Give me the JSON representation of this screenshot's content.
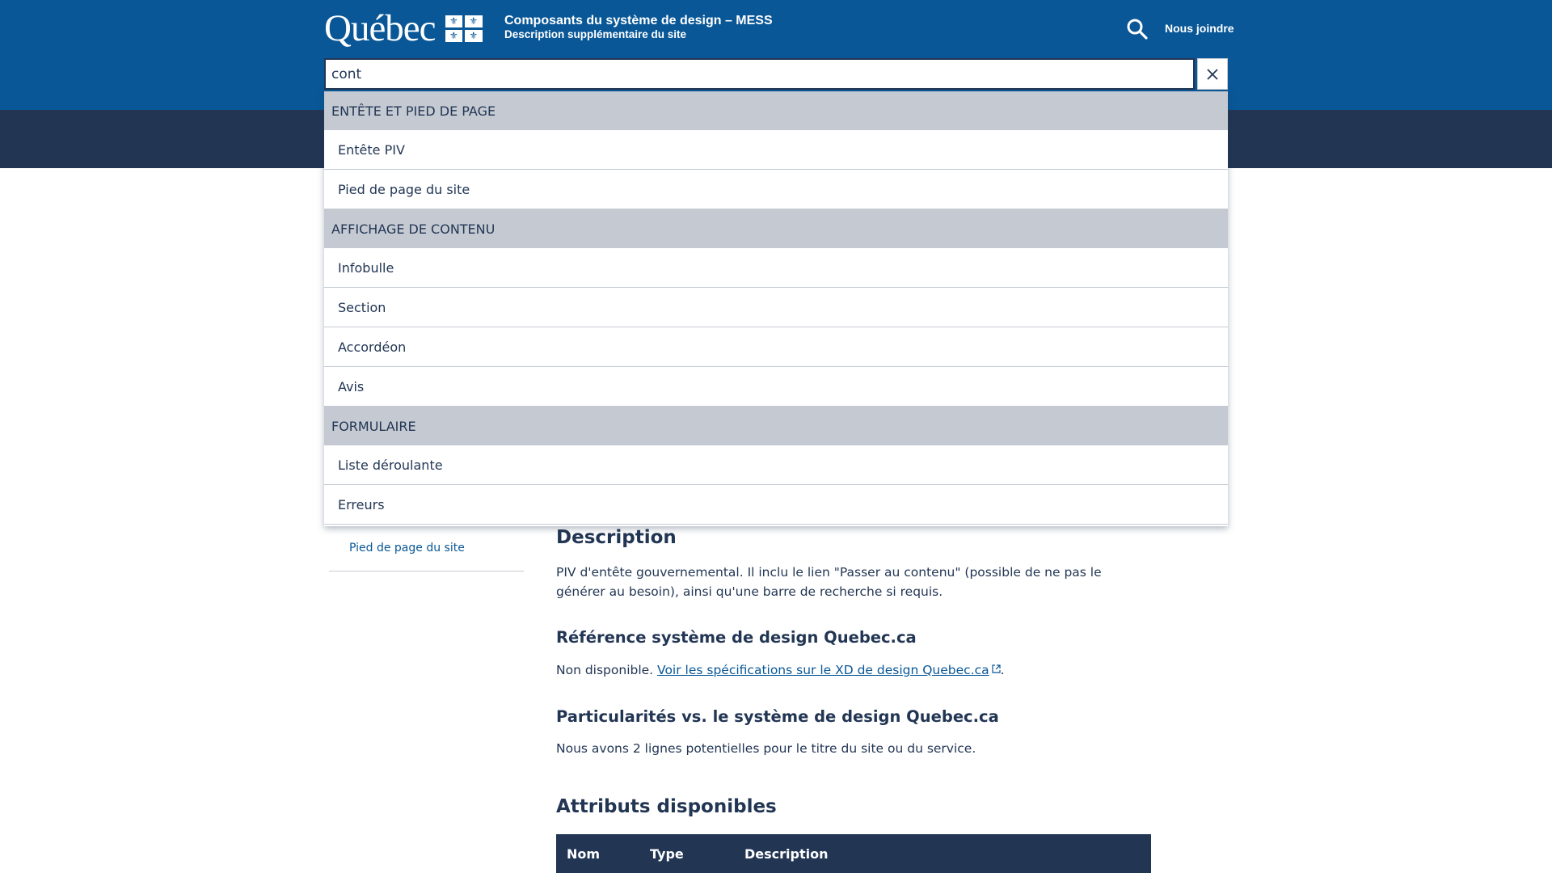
{
  "header": {
    "logo_text": "Québec",
    "site_title": "Composants du système de design – MESS",
    "site_description": "Description supplémentaire du site",
    "contact_label": "Nous joindre"
  },
  "search": {
    "value": "cont",
    "placeholder": ""
  },
  "results": {
    "groups": [
      {
        "title": "ENTÊTE ET PIED DE PAGE",
        "items": [
          "Entête PIV",
          "Pied de page du site"
        ]
      },
      {
        "title": "AFFICHAGE DE CONTENU",
        "items": [
          "Infobulle",
          "Section",
          "Accordéon",
          "Avis"
        ]
      },
      {
        "title": "FORMULAIRE",
        "items": [
          "Liste déroulante",
          "Erreurs"
        ]
      }
    ]
  },
  "sidebar": {
    "visible_link": "Pied de page du site"
  },
  "content": {
    "description_title": "Description",
    "description_text": "PIV d'entête gouvernemental. Il inclu le lien \"Passer au contenu\" (possible de ne pas le générer au besoin), ainsi qu'une barre de recherche si requis.",
    "reference_title": "Référence système de design Quebec.ca",
    "reference_prefix": "Non disponible. ",
    "reference_link": "Voir les spécifications sur le XD de design Quebec.ca",
    "reference_suffix": ".",
    "particularities_title": "Particularités vs. le système de design Quebec.ca",
    "particularities_text": "Nous avons 2 lignes potentielles pour le titre du site ou du service.",
    "attributes_title": "Attributs disponibles",
    "table_headers": [
      "Nom",
      "Type",
      "Description"
    ]
  },
  "colors": {
    "header_blue": "#095797",
    "dark_blue": "#223654",
    "group_gray": "#c5cad2"
  },
  "icons": {
    "search": "search-icon",
    "clear": "close-icon",
    "external": "external-link-icon",
    "flag": "fleur-de-lis-flag-icon"
  }
}
